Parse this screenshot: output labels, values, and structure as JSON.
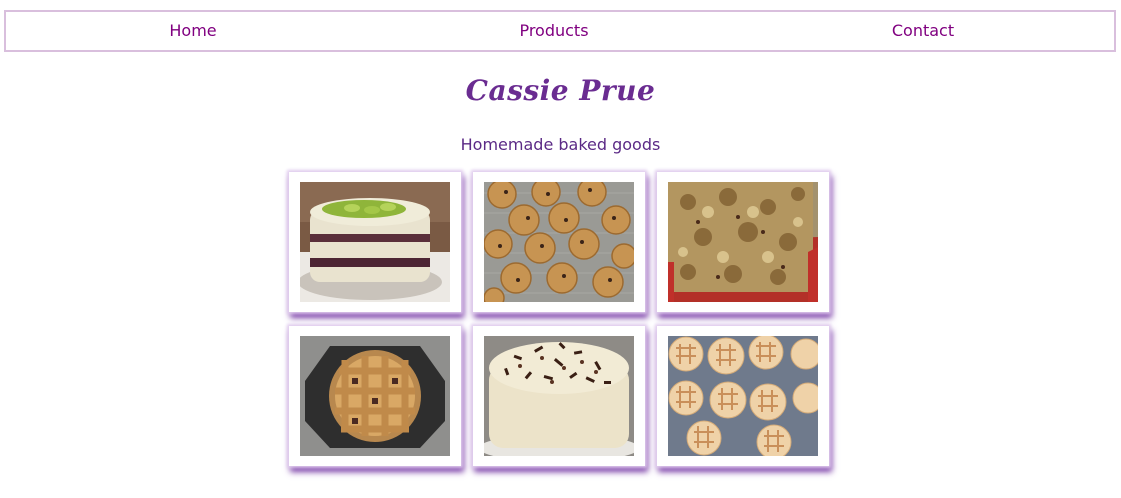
{
  "nav": {
    "home_label": "Home",
    "products_label": "Products",
    "contact_label": "Contact"
  },
  "header": {
    "title": "Cassie Prue",
    "subtitle": "Homemade baked goods"
  },
  "colors": {
    "link": "#800080",
    "title": "#6a2c91",
    "nav_border": "#d9bfdd",
    "card_shadow": "#7b3fa8"
  }
}
